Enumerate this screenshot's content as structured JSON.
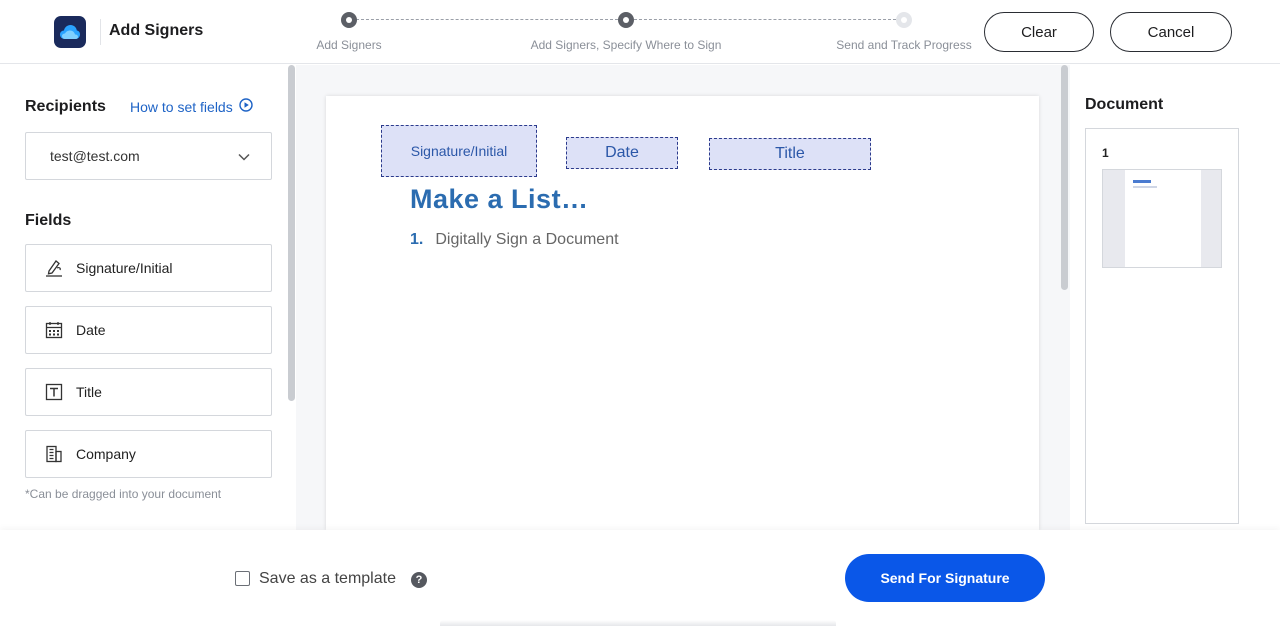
{
  "header": {
    "title": "Add Signers",
    "steps": [
      {
        "label": "Add Signers",
        "state": "done"
      },
      {
        "label": "Add Signers, Specify Where to Sign",
        "state": "done"
      },
      {
        "label": "Send and Track Progress",
        "state": "todo"
      }
    ],
    "clear_label": "Clear",
    "cancel_label": "Cancel"
  },
  "left": {
    "recipients_title": "Recipients",
    "how_to_link": "How to set fields",
    "recipient_selected": "test@test.com",
    "fields_title": "Fields",
    "fields": [
      {
        "label": "Signature/Initial",
        "icon": "signature-icon"
      },
      {
        "label": "Date",
        "icon": "calendar-icon"
      },
      {
        "label": "Title",
        "icon": "text-icon"
      },
      {
        "label": "Company",
        "icon": "building-icon"
      }
    ],
    "drag_note": "*Can be dragged into your document"
  },
  "document": {
    "placed_fields": [
      {
        "label": "Signature/Initial"
      },
      {
        "label": "Date"
      },
      {
        "label": "Title"
      }
    ],
    "heading": "Make a List…",
    "list_number": "1.",
    "list_text": "Digitally Sign a Document"
  },
  "right": {
    "title": "Document",
    "page_number": "1"
  },
  "footer": {
    "template_label": "Save as a template",
    "help": "?",
    "send_label": "Send For Signature"
  },
  "colors": {
    "primary": "#0a57e8",
    "link": "#1e63c6",
    "field_fill": "#dde1f7",
    "field_border": "#2b3a8c",
    "doc_heading": "#2b6cb0"
  }
}
